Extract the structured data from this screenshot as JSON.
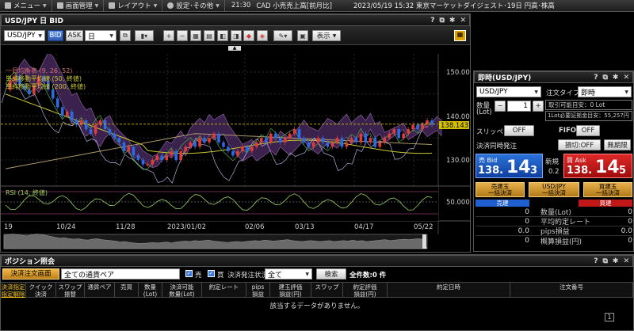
{
  "topbar": {
    "menu": "メニュー",
    "screen": "画面管理",
    "layout": "レイアウト",
    "settings": "設定･その他",
    "time": "21:30",
    "ticker": "CAD 小売売上高[前月比]",
    "news": "2023/05/19 15:32 東京マーケットダイジェスト･19日 円高･株高"
  },
  "chart_window": {
    "title": "USD/JPY 日 BID",
    "pair": "USD/JPY",
    "bid": "BID",
    "ask": "ASK",
    "period": "日",
    "display": "表示",
    "legend": {
      "ichimoku": "一目均衡表 (9, 26, 52)",
      "sma50": "単純移動平均線 (50, 終値)",
      "sma200": "単純移動平均線 (200, 終値)",
      "rsi": "RSI (14, 終値)"
    },
    "price_axis": [
      "150.000",
      "140.000",
      "130.000"
    ],
    "current_price": "138.143",
    "rsi_axis": "50.000",
    "dates": [
      "19",
      "10/24",
      "11/28",
      "2023/01/02",
      "02/06",
      "03/13",
      "04/17",
      "05/22"
    ],
    "colors": {
      "up": "#e23b3b",
      "down": "#2f6ae6",
      "sma50": "#c8c832",
      "sma200": "#b09a6a",
      "current": "#d4c000"
    }
  },
  "order_window": {
    "title": "即時(USD/JPY)",
    "pair": "USD/JPY",
    "order_type_label": "注文タイプ",
    "order_type": "即時",
    "qty_label": "数量",
    "qty_unit": "(Lot)",
    "qty_value": "1",
    "tradable": "取引可能目安：0 Lot",
    "margin": "1Lot必要証拠金目安：55,257円",
    "slippage_label": "スリッページ",
    "slippage": "OFF",
    "fifo_label": "FIFO",
    "fifo": "OFF",
    "settle_label": "決済同時発注",
    "loss_cut": "損切:OFF",
    "no_limit": "無期限",
    "sell_label": "売 Bid",
    "sell_price_big": "138.",
    "sell_price_pips": "14",
    "sell_price_last": "3",
    "new_label": "新規",
    "spread": "0.2",
    "buy_label": "買 Ask",
    "buy_price_big": "138.",
    "buy_price_pips": "14",
    "buy_price_last": "5",
    "sell_close_l1": "売建玉",
    "sell_close_l2": "一括決済",
    "pair_close_l1": "USD/JPY",
    "pair_close_l2": "一括決済",
    "buy_close_l1": "買建玉",
    "buy_close_l2": "一括決済",
    "sell_header": "売建",
    "buy_header": "買建",
    "rows": [
      {
        "sell": "0",
        "label": "数量(Lot)",
        "buy": "0"
      },
      {
        "sell": "0",
        "label": "平均約定レート",
        "buy": "0"
      },
      {
        "sell": "0.0",
        "label": "pips損益",
        "buy": "0.0"
      },
      {
        "sell": "0",
        "label": "概算損益(円)",
        "buy": "0"
      }
    ]
  },
  "position_window": {
    "title": "ポジション照会",
    "settle_order": "決済注文画面",
    "pair_filter": "全ての通貨ペア",
    "sell_check": "売",
    "buy_check": "買",
    "status_label": "決済発注状況",
    "status_value": "全て",
    "search": "検索",
    "count": "全件数:0 件",
    "headers": [
      {
        "l1": "決済指定",
        "l2": "指定解除"
      },
      {
        "l1": "クイック",
        "l2": "決済"
      },
      {
        "l1": "スワップ",
        "l2": "振替"
      },
      {
        "l1": "通貨ペア",
        "l2": ""
      },
      {
        "l1": "売買",
        "l2": ""
      },
      {
        "l1": "数量",
        "l2": "(Lot)"
      },
      {
        "l1": "決済可能",
        "l2": "数量(Lot)"
      },
      {
        "l1": "約定レート",
        "l2": ""
      },
      {
        "l1": "pips",
        "l2": "損益"
      },
      {
        "l1": "建玉評価",
        "l2": "損益(円)"
      },
      {
        "l1": "スワップ",
        "l2": ""
      },
      {
        "l1": "約定評価",
        "l2": "損益(円)"
      },
      {
        "l1": "約定日時",
        "l2": ""
      },
      {
        "l1": "注文番号",
        "l2": ""
      }
    ],
    "empty_message": "該当するデータがありません。",
    "page": "1"
  }
}
